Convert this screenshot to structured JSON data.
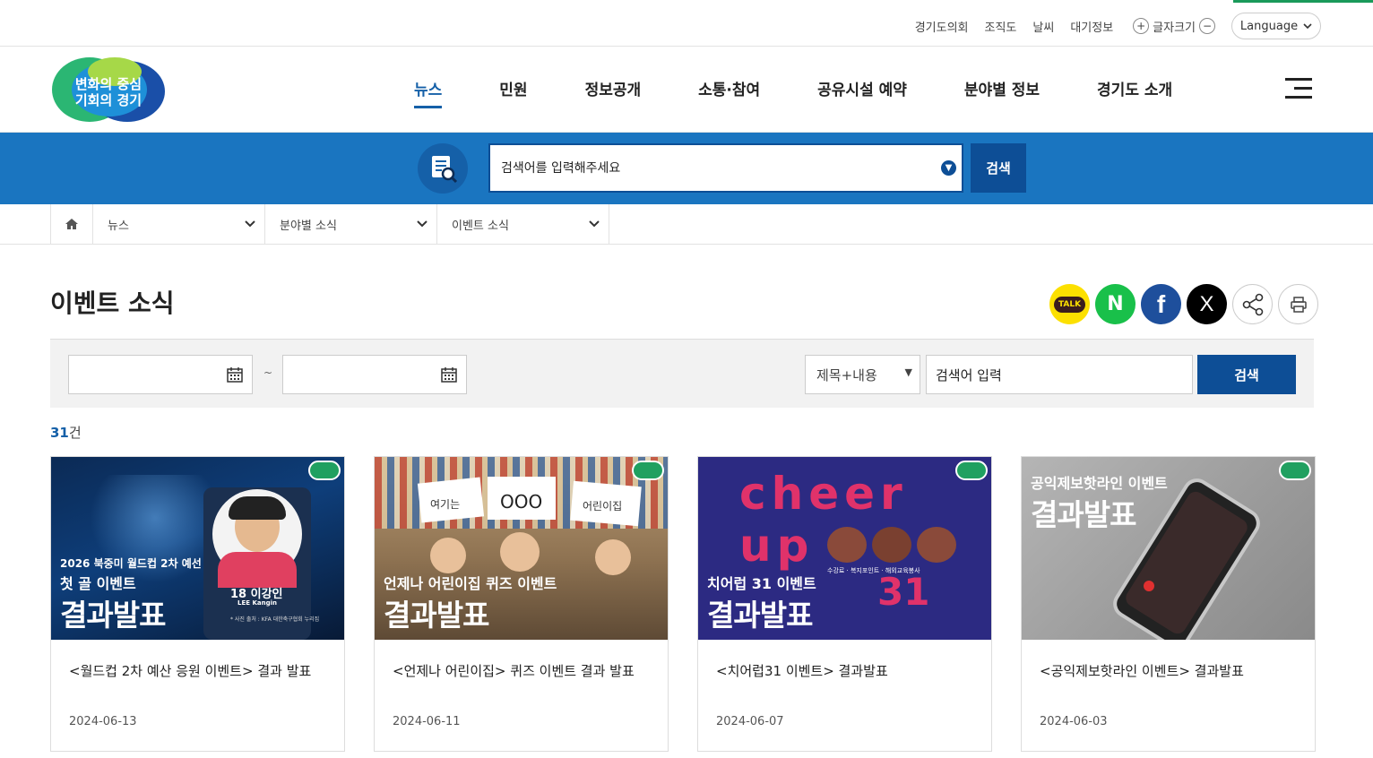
{
  "topbar": {
    "links": [
      "경기도의회",
      "조직도",
      "날씨",
      "대기정보"
    ],
    "font_size_label": "글자크기",
    "font_plus": "+",
    "font_minus": "−",
    "language": "Language"
  },
  "logo": {
    "line1": "변화의 중심",
    "line2": "기회의 경기"
  },
  "nav": {
    "items": [
      "뉴스",
      "민원",
      "정보공개",
      "소통·참여",
      "공유시설 예약",
      "분야별 정보",
      "경기도 소개"
    ],
    "active_index": 0
  },
  "search": {
    "placeholder": "검색어를 입력해주세요",
    "button": "검색"
  },
  "breadcrumb": {
    "items": [
      "뉴스",
      "분야별 소식",
      "이벤트 소식"
    ]
  },
  "page": {
    "title": "이벤트 소식"
  },
  "share": {
    "kakao": "TALK",
    "naver": "N",
    "facebook": "f",
    "x": "X"
  },
  "filter": {
    "date_sep": "~",
    "select_value": "제목+내용",
    "keyword_placeholder": "검색어 입력",
    "button": "검색"
  },
  "result": {
    "count": "31",
    "unit": "건"
  },
  "cards": [
    {
      "title": "<월드컵 2차 예산 응원 이벤트> 결과 발표",
      "date": "2024-06-13",
      "img_sub": "2026 북중미 월드컵 2차 예선",
      "img_line1": "첫 골 이벤트",
      "img_line2": "결과발표",
      "img_extra": "18 이강인",
      "img_extra2": "LEE Kangin",
      "img_extra3": "* 사진 출처 : KFA 대한축구협회 누리집",
      "bg": "#10284a"
    },
    {
      "title": "<언제나 어린이집> 퀴즈 이벤트 결과 발표",
      "date": "2024-06-11",
      "img_sub": "",
      "img_line1": "언제나 어린이집 퀴즈 이벤트",
      "img_line2": "결과발표",
      "img_extra": "여기는",
      "img_extra2": "OOO",
      "img_extra3": "어린이집",
      "bg": "#8a6a4a"
    },
    {
      "title": "<치어럽31 이벤트> 결과발표",
      "date": "2024-06-07",
      "img_sub": "",
      "img_line1": "치어럽 31 이벤트",
      "img_line2": "결과발표",
      "img_extra": "cheer up",
      "img_extra2": "31",
      "img_extra3": "수강료 · 복지포인트 · 해외교육봉사",
      "bg": "#2a2a7a"
    },
    {
      "title": "<공익제보핫라인 이벤트> 결과발표",
      "date": "2024-06-03",
      "img_sub": "",
      "img_line1": "공익제보핫라인 이벤트",
      "img_line2": "결과발표",
      "img_extra": "",
      "img_extra2": "",
      "img_extra3": "",
      "bg": "#9a9a9a"
    }
  ]
}
